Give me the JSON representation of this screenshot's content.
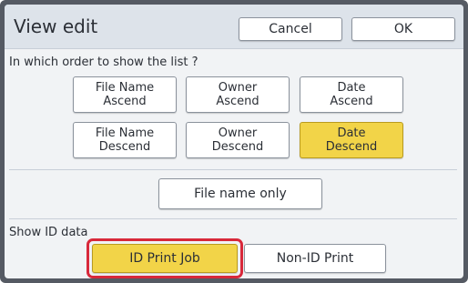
{
  "dialog": {
    "title": "View edit",
    "cancel_label": "Cancel",
    "ok_label": "OK"
  },
  "sort": {
    "prompt": "In which order to show the list ?",
    "options": [
      {
        "label": "File Name\nAscend",
        "selected": false
      },
      {
        "label": "Owner\nAscend",
        "selected": false
      },
      {
        "label": "Date\nAscend",
        "selected": false
      },
      {
        "label": "File Name\nDescend",
        "selected": false
      },
      {
        "label": "Owner\nDescend",
        "selected": false
      },
      {
        "label": "Date\nDescend",
        "selected": true
      }
    ],
    "file_name_only_label": "File name only"
  },
  "id_data": {
    "label": "Show ID data",
    "options": [
      {
        "label": "ID Print Job",
        "selected": true,
        "highlighted": true
      },
      {
        "label": "Non-ID Print",
        "selected": false
      }
    ]
  },
  "colors": {
    "selected": "#f2d448",
    "highlight_border": "#d8283a",
    "frame": "#555a63"
  }
}
